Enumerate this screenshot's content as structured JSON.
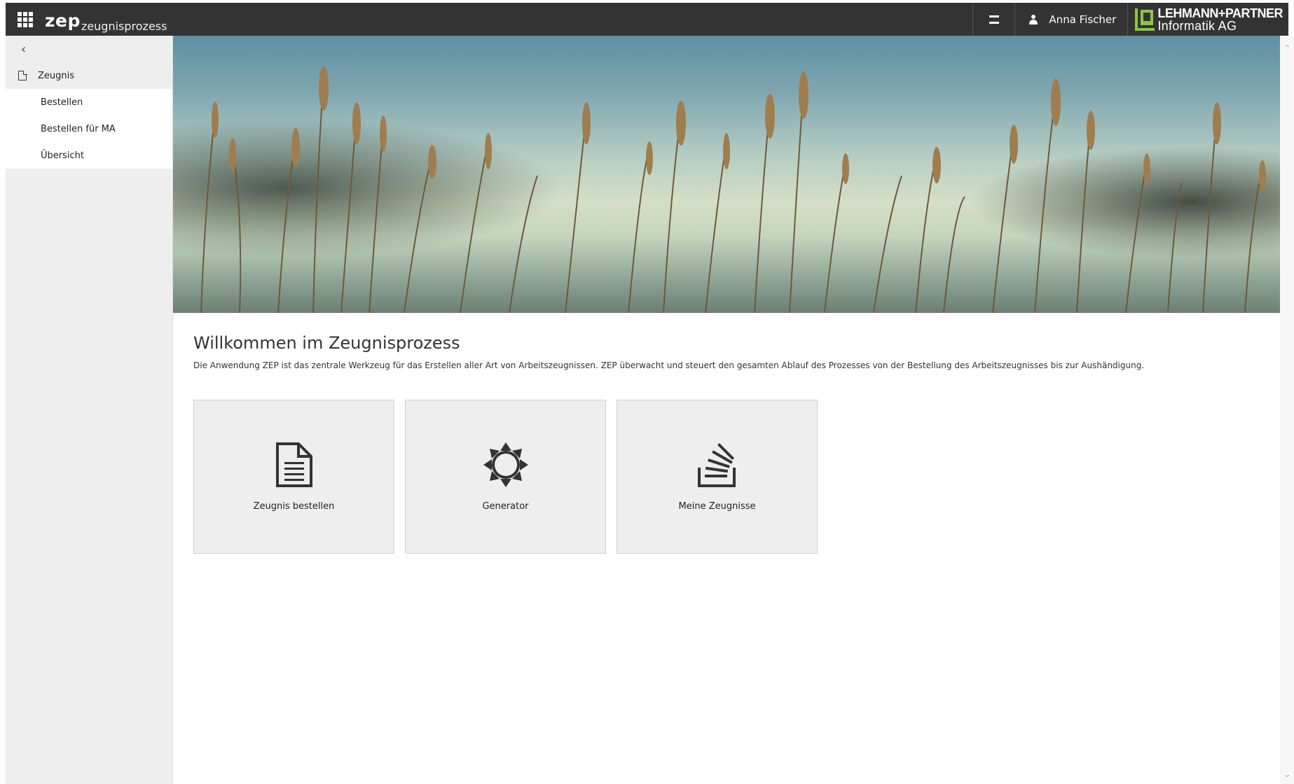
{
  "header": {
    "brand_main": "zep",
    "brand_sub": "zeugnisprozess",
    "user_name": "Anna Fischer",
    "logo_line1": "LEHMANN+PARTNER",
    "logo_line2": "Informatik AG",
    "icons": {
      "apps": "apps-grid-icon",
      "cards": "cards-icon",
      "user": "user-icon"
    }
  },
  "sidebar": {
    "back": "‹",
    "section": "Zeugnis",
    "items": [
      {
        "label": "Bestellen"
      },
      {
        "label": "Bestellen für MA"
      },
      {
        "label": "Übersicht"
      }
    ]
  },
  "main": {
    "title": "Willkommen im Zeugnisprozess",
    "description": "Die Anwendung ZEP ist das zentrale Werkzeug für das Erstellen aller Art von Arbeitszeugnissen. ZEP überwacht und steuert den gesamten Ablauf des Prozesses von der Bestellung des Arbeitszeugnisses bis zur Aushändigung.",
    "tiles": [
      {
        "label": "Zeugnis bestellen",
        "icon": "document-icon"
      },
      {
        "label": "Generator",
        "icon": "sun-icon"
      },
      {
        "label": "Meine Zeugnisse",
        "icon": "stack-icon"
      }
    ]
  },
  "colors": {
    "topbar": "#333333",
    "sidebar": "#eeeeee",
    "tile": "#eeeeee",
    "logo_green": "#8cc63f"
  }
}
